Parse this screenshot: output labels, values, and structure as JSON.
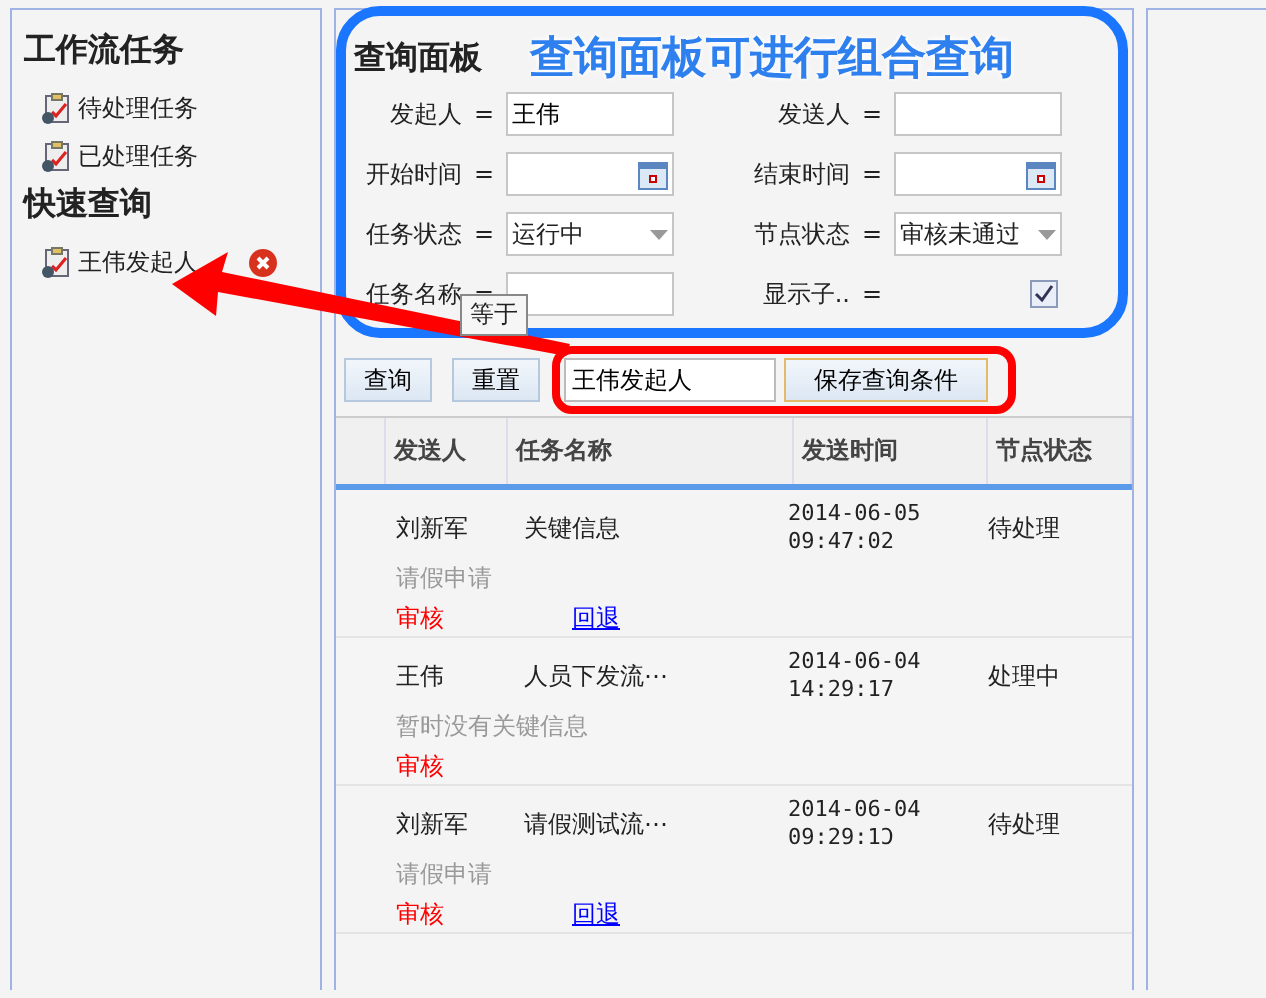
{
  "sidebar": {
    "sections": [
      {
        "title": "工作流任务",
        "items": [
          {
            "label": "待处理任务",
            "deletable": false
          },
          {
            "label": "已处理任务",
            "deletable": false
          }
        ]
      },
      {
        "title": "快速查询",
        "items": [
          {
            "label": "王伟发起人",
            "deletable": true
          }
        ]
      }
    ]
  },
  "query_panel": {
    "title": "查询面板",
    "fields": [
      {
        "kind": "text",
        "label": "发起人",
        "operator": "=",
        "value": "王伟"
      },
      {
        "kind": "text",
        "label": "发送人",
        "operator": "="
      },
      {
        "kind": "date",
        "label": "开始时间",
        "operator": "="
      },
      {
        "kind": "date",
        "label": "结束时间",
        "operator": "="
      },
      {
        "kind": "select",
        "label": "任务状态",
        "operator": "=",
        "value": "运行中"
      },
      {
        "kind": "select",
        "label": "节点状态",
        "operator": "=",
        "value": "审核未通过"
      },
      {
        "kind": "text",
        "label": "任务名称",
        "operator": "=",
        "tooltip": "等于"
      },
      {
        "kind": "checkbox",
        "label": "显示子..",
        "operator": "=",
        "checked": true
      }
    ],
    "buttons": [
      "查询",
      "重置"
    ],
    "save_name": {
      "value": "王伟发起人"
    },
    "save_button": "保存查询条件"
  },
  "table": {
    "columns": [
      "发送人",
      "任务名称",
      "发送时间",
      "节点状态"
    ],
    "rows": [
      {
        "sender": "刘新军",
        "task": "关键信息",
        "date": "2014-06-05",
        "time": "09:47:02",
        "status": "待处理",
        "info": "请假申请",
        "actions": [
          {
            "label": "审核",
            "kind": "approve"
          },
          {
            "label": "回退",
            "kind": "return"
          }
        ]
      },
      {
        "sender": "王伟",
        "task": "人员下发流⋯",
        "date": "2014-06-04",
        "time": "14:29:17",
        "status": "处理中",
        "info": "暂时没有关键信息",
        "actions": [
          {
            "label": "审核",
            "kind": "approve"
          }
        ]
      },
      {
        "sender": "刘新军",
        "task": "请假测试流⋯",
        "date": "2014-06-04",
        "time": "09:29:1Ͻ",
        "status": "待处理",
        "info": "请假申请",
        "actions": [
          {
            "label": "审核",
            "kind": "approve"
          },
          {
            "label": "回退",
            "kind": "return"
          }
        ]
      }
    ]
  },
  "annotation": {
    "caption": "查询面板可进行组合查询"
  }
}
